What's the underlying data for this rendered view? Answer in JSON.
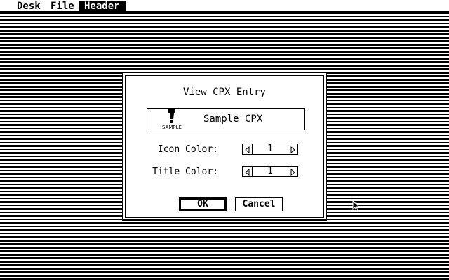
{
  "menubar": {
    "items": [
      {
        "label": "Desk"
      },
      {
        "label": "File"
      },
      {
        "label": "Header",
        "active": true
      }
    ]
  },
  "dialog": {
    "title": "View CPX Entry",
    "preview": {
      "icon_text": "SAMPLE",
      "name": "Sample CPX",
      "icon": "cpx-sample-icon"
    },
    "icon_color": {
      "label": "Icon Color:",
      "value": "1"
    },
    "title_color": {
      "label": "Title Color:",
      "value": "1"
    },
    "ok_label": "OK",
    "cancel_label": "Cancel"
  },
  "colors": {
    "foreground": "#000000",
    "background": "#ffffff"
  }
}
